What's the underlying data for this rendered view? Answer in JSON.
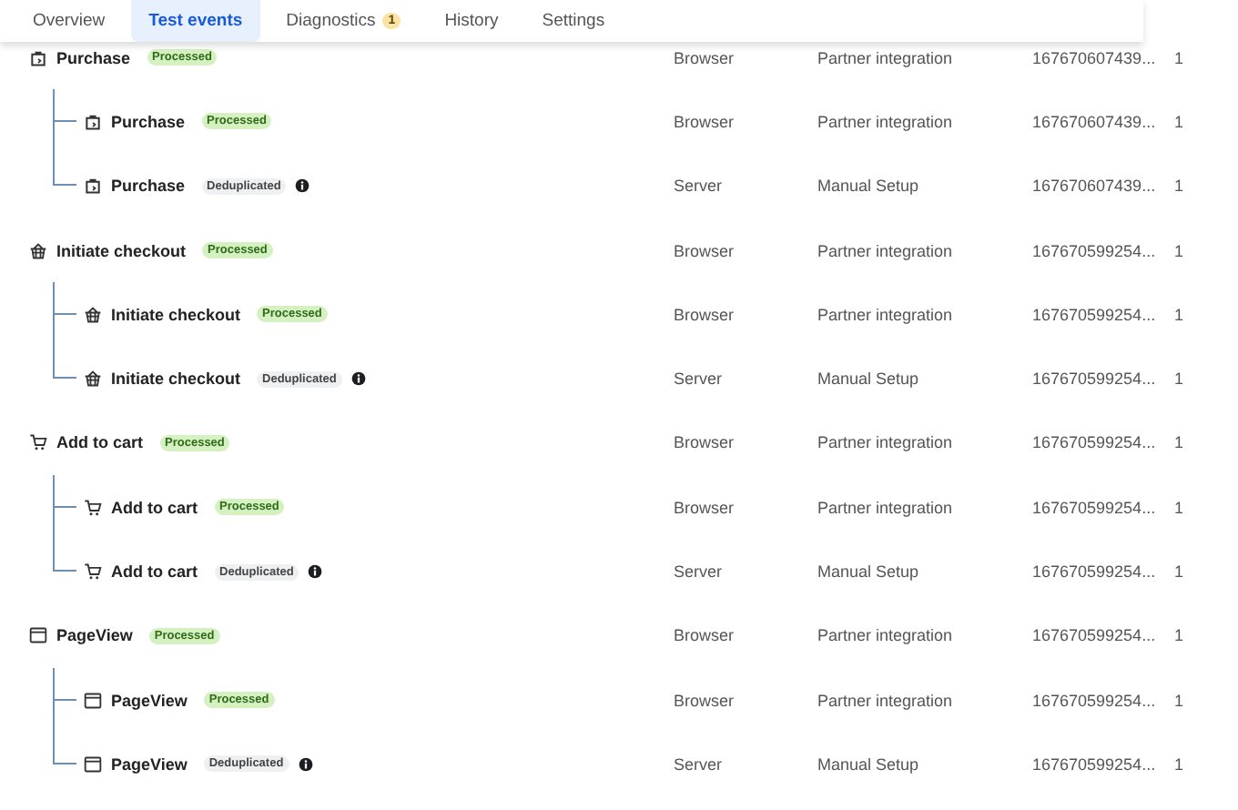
{
  "tabs": [
    {
      "label": "Overview",
      "selected": false
    },
    {
      "label": "Test events",
      "selected": true
    },
    {
      "label": "Diagnostics",
      "selected": false,
      "badge": "1"
    },
    {
      "label": "History",
      "selected": false
    },
    {
      "label": "Settings",
      "selected": false
    }
  ],
  "events": [
    {
      "name": "Purchase",
      "status": {
        "kind": "processed",
        "label": "Processed"
      },
      "source": "Browser",
      "setup": "Partner integration",
      "id": "167670607439...",
      "column_5": "1",
      "children": [
        {
          "name": "Purchase",
          "status": {
            "kind": "processed",
            "label": "Processed"
          },
          "source": "Browser",
          "setup": "Partner integration",
          "id": "167670607439...",
          "column_5": "1"
        },
        {
          "name": "Purchase",
          "status": {
            "kind": "deduplicated",
            "label": "Deduplicated"
          },
          "source": "Server",
          "setup": "Manual Setup",
          "id": "167670607439...",
          "column_5": "1"
        }
      ]
    },
    {
      "name": "Initiate checkout",
      "status": {
        "kind": "processed",
        "label": "Processed"
      },
      "source": "Browser",
      "setup": "Partner integration",
      "id": "167670599254...",
      "column_5": "1",
      "children": [
        {
          "name": "Initiate checkout",
          "status": {
            "kind": "processed",
            "label": "Processed"
          },
          "source": "Browser",
          "setup": "Partner integration",
          "id": "167670599254...",
          "column_5": "1"
        },
        {
          "name": "Initiate checkout",
          "status": {
            "kind": "deduplicated",
            "label": "Deduplicated"
          },
          "source": "Server",
          "setup": "Manual Setup",
          "id": "167670599254...",
          "column_5": "1"
        }
      ]
    },
    {
      "name": "Add to cart",
      "status": {
        "kind": "processed",
        "label": "Processed"
      },
      "source": "Browser",
      "setup": "Partner integration",
      "id": "167670599254...",
      "column_5": "1",
      "children": [
        {
          "name": "Add to cart",
          "status": {
            "kind": "processed",
            "label": "Processed"
          },
          "source": "Browser",
          "setup": "Partner integration",
          "id": "167670599254...",
          "column_5": "1"
        },
        {
          "name": "Add to cart",
          "status": {
            "kind": "deduplicated",
            "label": "Deduplicated"
          },
          "source": "Server",
          "setup": "Manual Setup",
          "id": "167670599254...",
          "column_5": "1"
        }
      ]
    },
    {
      "name": "PageView",
      "status": {
        "kind": "processed",
        "label": "Processed"
      },
      "source": "Browser",
      "setup": "Partner integration",
      "id": "167670599254...",
      "column_5": "1",
      "children": [
        {
          "name": "PageView",
          "status": {
            "kind": "processed",
            "label": "Processed"
          },
          "source": "Browser",
          "setup": "Partner integration",
          "id": "167670599254...",
          "column_5": "1"
        },
        {
          "name": "PageView",
          "status": {
            "kind": "deduplicated",
            "label": "Deduplicated"
          },
          "source": "Server",
          "setup": "Manual Setup",
          "id": "167670599254...",
          "column_5": "1"
        }
      ]
    }
  ]
}
